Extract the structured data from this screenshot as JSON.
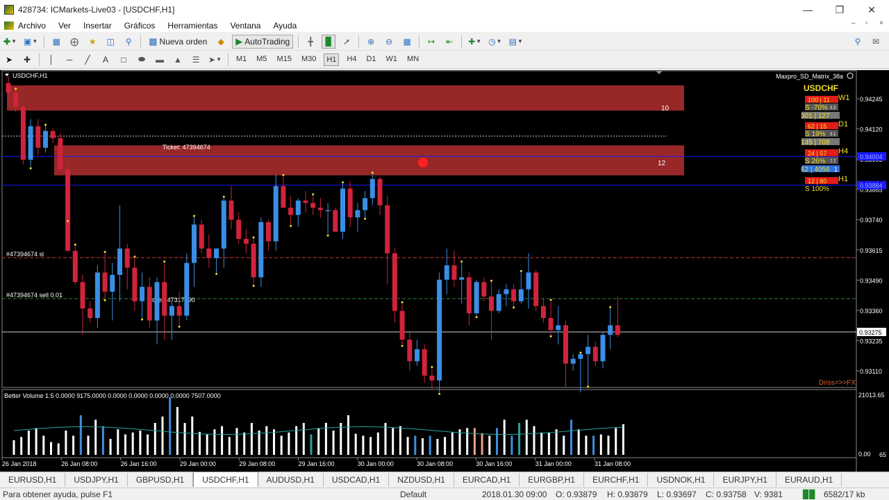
{
  "window": {
    "title": "428734: ICMarkets-Live03 - [USDCHF,H1]"
  },
  "menu": [
    "Archivo",
    "Ver",
    "Insertar",
    "Gráficos",
    "Herramientas",
    "Ventana",
    "Ayuda"
  ],
  "toolbar": {
    "new_order": "Nueva orden",
    "autotrading": "AutoTrading"
  },
  "timeframes": [
    "M1",
    "M5",
    "M15",
    "M30",
    "H1",
    "H4",
    "D1",
    "W1",
    "MN"
  ],
  "active_timeframe": "H1",
  "chart": {
    "symbol_label": "USDCHF,H1",
    "indicator_name": "Maxpro_SD_Matrix_38a",
    "watermark": "Driss=>>FX",
    "zone_labels": [
      "10",
      "12"
    ],
    "ticket_upper": "Ticket: 47394674",
    "ticket_lower": "Ticket: 47317690",
    "sl_label": "#47394674 sl",
    "sell_label": "#47394674 sell 0.01",
    "current_price": "0.93275",
    "price_marker_1": "0.94004",
    "price_marker_2": "0.93884",
    "price_axis": [
      "0.94245",
      "0.94120",
      "0.93995",
      "0.93865",
      "0.93740",
      "0.93615",
      "0.93490",
      "0.93360",
      "0.93235",
      "0.93110"
    ],
    "volume_title": "Better Volume 1.5 0.0000 9175.0000 0.0000 0.0000 0.0000 0.0000 7507.0000",
    "volume_axis_top": "21013.65",
    "volume_axis_bottom": "0.00",
    "volume_axis_bottom_tail": "65",
    "time_axis": [
      "26 Jan 2018",
      "26 Jan 08:00",
      "26 Jan 16:00",
      "29 Jan 00:00",
      "29 Jan 08:00",
      "29 Jan 16:00",
      "30 Jan 00:00",
      "30 Jan 08:00",
      "30 Jan 16:00",
      "31 Jan 00:00",
      "31 Jan 08:00"
    ],
    "matrix": {
      "title": "USDCHF",
      "rows": [
        {
          "tf": "W1",
          "line1": "100 | 11",
          "line2": "S -70%",
          "line3": "301 | 127",
          "tiny": "3.3"
        },
        {
          "tf": "D1",
          "line1": "62 | 15",
          "line2": "S 19%",
          "line3": "145 | 708",
          "tiny": "3.1"
        },
        {
          "tf": "H4",
          "line1": "24 | 57",
          "line2": "S 26%",
          "line3": "62 | 4056",
          "tiny": "7.7",
          "suffix": "1"
        },
        {
          "tf": "H1",
          "line1": "12 | 80",
          "line2": "S 100%"
        }
      ]
    }
  },
  "symbol_tabs": [
    "EURUSD,H1",
    "USDJPY,H1",
    "GBPUSD,H1",
    "USDCHF,H1",
    "AUDUSD,H1",
    "USDCAD,H1",
    "NZDUSD,H1",
    "EURCAD,H1",
    "EURGBP,H1",
    "EURCHF,H1",
    "USDNOK,H1",
    "EURJPY,H1",
    "EURAUD,H1"
  ],
  "active_tab": "USDCHF,H1",
  "status": {
    "help": "Para obtener ayuda, pulse F1",
    "profile": "Default",
    "datetime": "2018.01.30 09:00",
    "open": "O: 0.93879",
    "high": "H: 0.93879",
    "low": "L: 0.93697",
    "close": "C: 0.93758",
    "volume": "V: 9381",
    "traffic": "6582/17 kb"
  },
  "candles": [
    [
      0.9431,
      0.9434,
      0.9424,
      0.9427
    ],
    [
      0.9427,
      0.9428,
      0.9419,
      0.9421
    ],
    [
      0.9421,
      0.9422,
      0.9397,
      0.9399
    ],
    [
      0.9399,
      0.9416,
      0.9396,
      0.9413
    ],
    [
      0.9413,
      0.9416,
      0.9401,
      0.9404
    ],
    [
      0.9404,
      0.9413,
      0.9402,
      0.9411
    ],
    [
      0.9411,
      0.9412,
      0.9406,
      0.9408
    ],
    [
      0.9408,
      0.941,
      0.9394,
      0.9395
    ],
    [
      0.9395,
      0.9397,
      0.9374,
      0.9361
    ],
    [
      0.9361,
      0.9363,
      0.9347,
      0.9348
    ],
    [
      0.9348,
      0.9351,
      0.9326,
      0.9337
    ],
    [
      0.9337,
      0.934,
      0.9331,
      0.9333
    ],
    [
      0.9333,
      0.9355,
      0.9329,
      0.9352
    ],
    [
      0.9352,
      0.936,
      0.9341,
      0.9344
    ],
    [
      0.9344,
      0.9356,
      0.9332,
      0.9351
    ],
    [
      0.9351,
      0.938,
      0.934,
      0.9362
    ],
    [
      0.9362,
      0.9364,
      0.9345,
      0.9354
    ],
    [
      0.9354,
      0.9358,
      0.9336,
      0.934
    ],
    [
      0.934,
      0.9352,
      0.9333,
      0.9346
    ],
    [
      0.9346,
      0.935,
      0.9329,
      0.9332
    ],
    [
      0.9332,
      0.935,
      0.9322,
      0.9348
    ],
    [
      0.9348,
      0.9356,
      0.9324,
      0.9334
    ],
    [
      0.9334,
      0.934,
      0.9324,
      0.9338
    ],
    [
      0.9338,
      0.9344,
      0.933,
      0.9334
    ],
    [
      0.9334,
      0.936,
      0.9332,
      0.9356
    ],
    [
      0.9356,
      0.9375,
      0.9346,
      0.9372
    ],
    [
      0.9372,
      0.9374,
      0.936,
      0.9362
    ],
    [
      0.9362,
      0.9368,
      0.9354,
      0.9358
    ],
    [
      0.9358,
      0.9362,
      0.9352,
      0.9362
    ],
    [
      0.9362,
      0.9383,
      0.9354,
      0.9382
    ],
    [
      0.9382,
      0.9388,
      0.937,
      0.9374
    ],
    [
      0.9374,
      0.9377,
      0.9364,
      0.9366
    ],
    [
      0.9366,
      0.937,
      0.936,
      0.9364
    ],
    [
      0.9364,
      0.9366,
      0.9347,
      0.935
    ],
    [
      0.935,
      0.9375,
      0.9346,
      0.9373
    ],
    [
      0.9373,
      0.9374,
      0.9361,
      0.9365
    ],
    [
      0.9365,
      0.9393,
      0.9361,
      0.9388
    ],
    [
      0.9388,
      0.9392,
      0.938,
      0.9379
    ],
    [
      0.9379,
      0.9384,
      0.9372,
      0.9376
    ],
    [
      0.9376,
      0.9383,
      0.9371,
      0.9382
    ],
    [
      0.9382,
      0.9386,
      0.9377,
      0.9381
    ],
    [
      0.9381,
      0.9384,
      0.9376,
      0.9379
    ],
    [
      0.9379,
      0.9383,
      0.9375,
      0.9378
    ],
    [
      0.9378,
      0.9381,
      0.9368,
      0.9378
    ],
    [
      0.9378,
      0.9379,
      0.9372,
      0.9369
    ],
    [
      0.9369,
      0.9389,
      0.9366,
      0.9387
    ],
    [
      0.9387,
      0.939,
      0.9371,
      0.9375
    ],
    [
      0.9375,
      0.9381,
      0.9369,
      0.9378
    ],
    [
      0.9378,
      0.9386,
      0.9375,
      0.9383
    ],
    [
      0.9383,
      0.9393,
      0.938,
      0.9391
    ],
    [
      0.9391,
      0.9392,
      0.9376,
      0.938
    ],
    [
      0.938,
      0.9384,
      0.9347,
      0.936
    ],
    [
      0.936,
      0.9362,
      0.9331,
      0.9336
    ],
    [
      0.9336,
      0.9339,
      0.9322,
      0.9324
    ],
    [
      0.9324,
      0.9327,
      0.9311,
      0.9315
    ],
    [
      0.9315,
      0.9324,
      0.9313,
      0.932
    ],
    [
      0.932,
      0.9322,
      0.9306,
      0.9309
    ],
    [
      0.9309,
      0.9312,
      0.9303,
      0.9307
    ],
    [
      0.9307,
      0.9352,
      0.9302,
      0.9349
    ],
    [
      0.9349,
      0.9362,
      0.9343,
      0.9355
    ],
    [
      0.9355,
      0.9361,
      0.9346,
      0.9349
    ],
    [
      0.9349,
      0.9356,
      0.9339,
      0.935
    ],
    [
      0.935,
      0.9352,
      0.933,
      0.9335
    ],
    [
      0.9335,
      0.9349,
      0.9334,
      0.9348
    ],
    [
      0.9348,
      0.935,
      0.934,
      0.9342
    ],
    [
      0.9342,
      0.9348,
      0.9324,
      0.9336
    ],
    [
      0.9336,
      0.9345,
      0.9335,
      0.9343
    ],
    [
      0.9343,
      0.9347,
      0.9338,
      0.9345
    ],
    [
      0.9345,
      0.9347,
      0.9338,
      0.934
    ],
    [
      0.934,
      0.9352,
      0.9339,
      0.9345
    ],
    [
      0.9345,
      0.936,
      0.9337,
      0.9352
    ],
    [
      0.9352,
      0.9353,
      0.9336,
      0.9338
    ],
    [
      0.9338,
      0.9341,
      0.9331,
      0.9333
    ],
    [
      0.9333,
      0.934,
      0.9326,
      0.9328
    ],
    [
      0.9328,
      0.9338,
      0.9322,
      0.933
    ],
    [
      0.933,
      0.9332,
      0.9304,
      0.9314
    ],
    [
      0.9314,
      0.9318,
      0.9311,
      0.9316
    ],
    [
      0.9316,
      0.9318,
      0.9302,
      0.9318
    ],
    [
      0.9318,
      0.9326,
      0.9305,
      0.9321
    ],
    [
      0.9321,
      0.9323,
      0.9313,
      0.9315
    ],
    [
      0.9315,
      0.9327,
      0.9312,
      0.9326
    ],
    [
      0.9326,
      0.9337,
      0.932,
      0.933
    ],
    [
      0.933,
      0.9342,
      0.9325,
      0.9326
    ]
  ],
  "volumes": [
    0.23,
    0.28,
    0.38,
    0.42,
    0.3,
    0.2,
    0.18,
    0.38,
    0.3,
    0.62,
    0.3,
    0.55,
    0.45,
    0.25,
    0.4,
    0.32,
    0.35,
    0.38,
    0.32,
    0.5,
    0.6,
    0.9,
    0.75,
    0.5,
    0.6,
    0.36,
    0.32,
    0.4,
    0.45,
    0.28,
    0.42,
    0.35,
    0.5,
    0.38,
    0.45,
    0.4,
    0.3,
    0.35,
    0.45,
    0.5,
    0.32,
    0.42,
    0.5,
    0.38,
    0.5,
    0.62,
    0.33,
    0.3,
    0.28,
    0.35,
    0.5,
    0.42,
    0.45,
    0.28,
    0.3,
    0.26,
    0.3,
    0.25,
    0.28,
    0.35,
    0.4,
    0.42,
    0.42,
    0.34,
    0.3,
    0.42,
    0.55,
    0.3,
    0.5,
    0.55,
    0.45,
    0.35,
    0.35,
    0.4,
    0.3,
    0.55,
    0.4,
    0.3,
    0.3,
    0.32,
    0.3,
    0.42,
    0.48
  ],
  "volume_colors": {
    "default": "#ffffff",
    "blue": "#3b8fe0",
    "teal": "#2aa39a",
    "salmon": "#f4a08c"
  }
}
